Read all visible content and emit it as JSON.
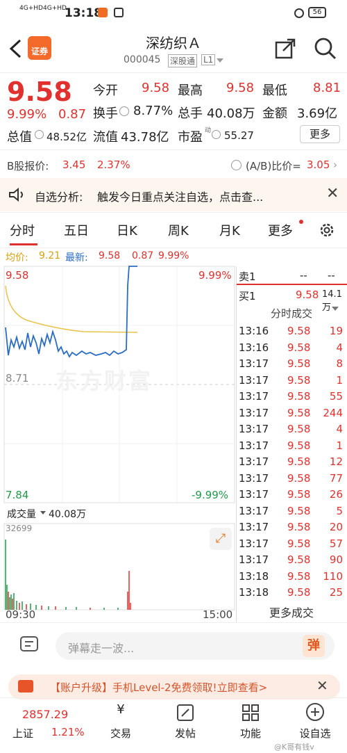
{
  "status": {
    "net1": "4G+HD",
    "net2": "4G+HD",
    "time": "13:18",
    "battery": "56"
  },
  "header": {
    "title": "深纺织Ａ",
    "code": "000045",
    "board": "深股通",
    "level": "L1",
    "logo": "证券"
  },
  "quote": {
    "price": "9.58",
    "change_pct": "9.99%",
    "change": "0.87",
    "today_open_label": "今开",
    "today_open": "9.58",
    "high_label": "最高",
    "high": "9.58",
    "low_label": "最低",
    "low": "8.81",
    "turnover_label": "换手",
    "turnover": "8.77%",
    "volume_label": "总手",
    "volume": "40.08万",
    "amount_label": "金额",
    "amount": "3.69亿",
    "mcap_label": "总值",
    "mcap": "48.52亿",
    "float_label": "流值",
    "float": "43.78亿",
    "pe_label": "市盈",
    "pe_sup": "动",
    "pe": "55.27",
    "more": "更多",
    "b_label": "B股报价:",
    "b_price": "3.45",
    "b_pct": "2.37%",
    "ab_label": "(A/B)比价=",
    "ab": "3.05"
  },
  "notice": {
    "title": "自选分析:",
    "text": "触发今日重点关注自选，点击查..."
  },
  "tabs": [
    "分时",
    "五日",
    "日K",
    "周K",
    "月K",
    "更多"
  ],
  "chart_info": {
    "avg_label": "均价:",
    "avg": "9.21",
    "latest_label": "最新:",
    "latest": "9.58",
    "chg": "0.87",
    "pct": "9.99%"
  },
  "chart": {
    "top": "9.58",
    "top_pct": "9.99%",
    "mid": "8.71",
    "bottom": "7.84",
    "bottom_pct": "-9.99%",
    "watermark": "东方财富",
    "vol_label": "成交量",
    "vol_total": "40.08万",
    "vol_max": "32699",
    "t_start": "09:30",
    "t_end": "15:00"
  },
  "book": {
    "ask_label": "卖1",
    "ask_p": "--",
    "ask_v": "--",
    "bid_label": "买1",
    "bid_p": "9.58",
    "bid_v": "14.1万",
    "trades_title": "分时成交",
    "more_trades": "更多成交"
  },
  "trades": [
    [
      "13:16",
      "9.58",
      "19"
    ],
    [
      "13:16",
      "9.58",
      "4"
    ],
    [
      "13:17",
      "9.58",
      "8"
    ],
    [
      "13:17",
      "9.58",
      "1"
    ],
    [
      "13:17",
      "9.58",
      "55"
    ],
    [
      "13:17",
      "9.58",
      "244"
    ],
    [
      "13:17",
      "9.58",
      "4"
    ],
    [
      "13:17",
      "9.58",
      "1"
    ],
    [
      "13:17",
      "9.58",
      "12"
    ],
    [
      "13:17",
      "9.58",
      "77"
    ],
    [
      "13:17",
      "9.58",
      "26"
    ],
    [
      "13:17",
      "9.58",
      "5"
    ],
    [
      "13:17",
      "9.58",
      "20"
    ],
    [
      "13:17",
      "9.58",
      "57"
    ],
    [
      "13:17",
      "9.58",
      "90"
    ],
    [
      "13:18",
      "9.58",
      "110"
    ],
    [
      "13:18",
      "9.58",
      "25"
    ]
  ],
  "comment": {
    "placeholder": "弹幕走一波...",
    "btn": "弹"
  },
  "ad": {
    "text": "【账户升级】手机Level-2免费领取!立即查看>"
  },
  "nav": {
    "index_val": "2857.29",
    "index_name": "上证",
    "index_pct": "1.21%",
    "items": [
      "交易",
      "发帖",
      "功能",
      "设自选"
    ],
    "watermark": "@K哥有钱v"
  },
  "chart_data": {
    "type": "line",
    "title": "",
    "x": [
      "09:30",
      "15:00"
    ],
    "ylim": [
      7.84,
      9.58
    ],
    "series": [
      {
        "name": "均价",
        "values": [
          9.21
        ]
      },
      {
        "name": "最新",
        "values": [
          9.58
        ]
      }
    ],
    "reference": 8.71
  }
}
